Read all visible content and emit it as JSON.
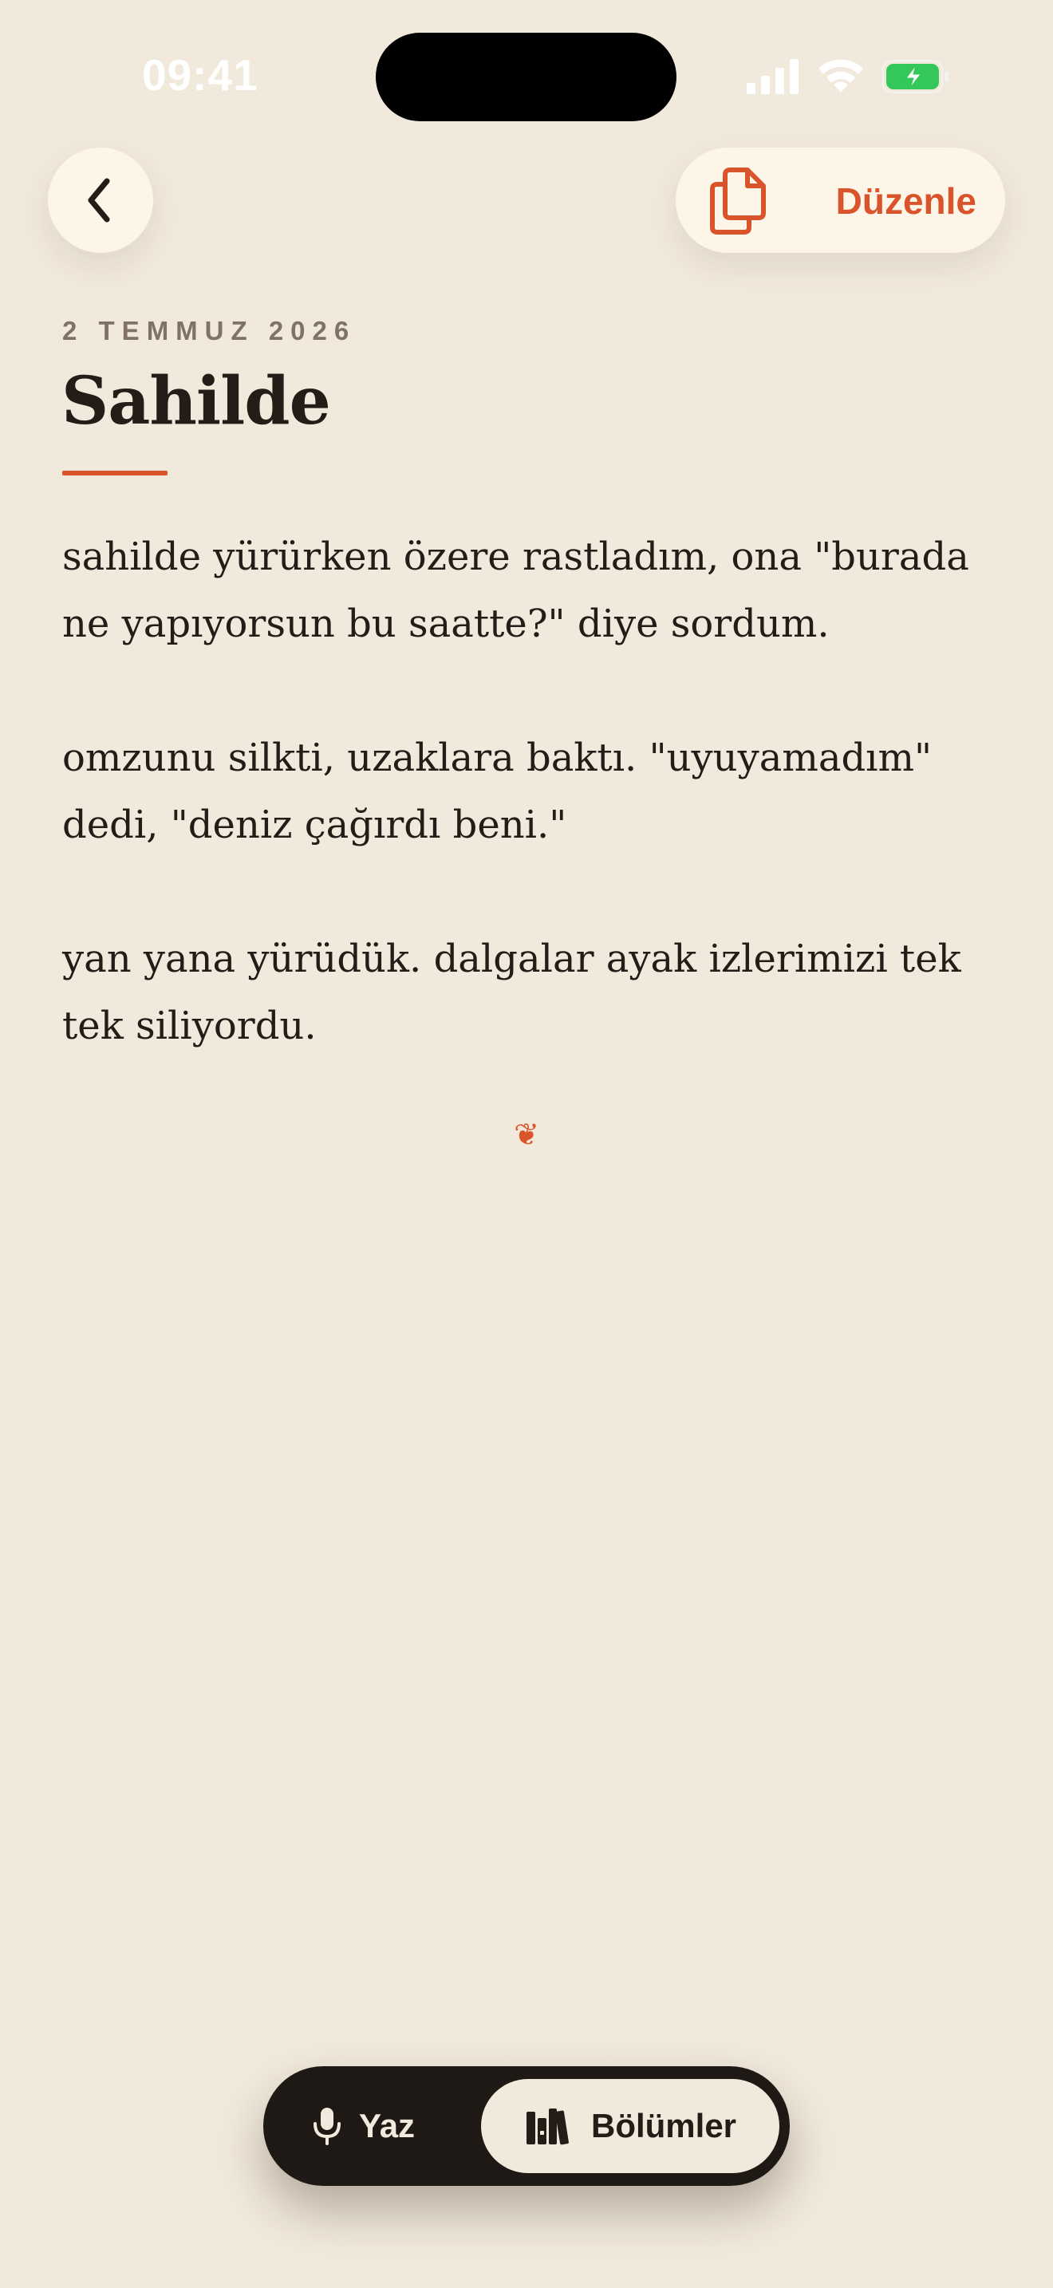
{
  "status_bar": {
    "time": "09:41",
    "signal_icon": "cellular-signal-icon",
    "wifi_icon": "wifi-icon",
    "battery_icon": "battery-charging-icon"
  },
  "nav": {
    "back_icon": "chevron-left-icon",
    "edit_icon": "documents-icon",
    "edit_label": "Düzenle"
  },
  "entry": {
    "date": "2 TEMMUZ 2026",
    "title": "Sahilde",
    "paragraphs": [
      "sahilde yürürken özere rastladım, ona \"burada ne yapıyorsun bu saatte?\" diye sordum.",
      "omzunu silkti, uzaklara baktı. \"uyuyamadım\" dedi, \"deniz çağırdı beni.\"",
      "yan yana yürüdük. dalgalar ayak izlerimizi tek tek siliyordu."
    ],
    "end_ornament": "❦"
  },
  "tab_bar": {
    "write_label": "Yaz",
    "write_icon": "microphone-icon",
    "sections_label": "Bölümler",
    "sections_icon": "books-icon"
  },
  "colors": {
    "background": "#f1e9dc",
    "accent": "#d9542b",
    "text": "#231c17",
    "muted": "#807364",
    "tab_bar": "#1f1915",
    "button_surface": "#fdf6e8"
  }
}
